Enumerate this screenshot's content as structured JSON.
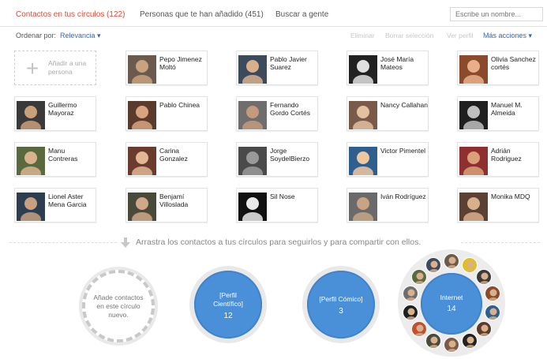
{
  "tabs": [
    {
      "label": "Contactos en tus círculos (122)",
      "active": true
    },
    {
      "label": "Personas que te han añadido (451)",
      "active": false
    },
    {
      "label": "Buscar a gente",
      "active": false
    }
  ],
  "search": {
    "placeholder": "Escribe un nombre..."
  },
  "toolbar": {
    "sort_label": "Ordenar por:",
    "sort_value": "Relevancia ▾",
    "actions": [
      "Eliminar",
      "Borrar selección",
      "Ver perfil"
    ],
    "more_actions": "Más acciones ▾"
  },
  "add_person": {
    "label": "Añadir a una persona"
  },
  "contacts": [
    {
      "name": "Pepo Jimenez Moltó"
    },
    {
      "name": "Pablo Javier Suarez"
    },
    {
      "name": "José María Mateos"
    },
    {
      "name": "Olivia Sanchez cortés"
    },
    {
      "name": "Guillermo Mayoraz"
    },
    {
      "name": "Pablo Chinea"
    },
    {
      "name": "Fernando Gordo Cortés"
    },
    {
      "name": "Nancy Callahan"
    },
    {
      "name": "Manuel M. Almeida"
    },
    {
      "name": "Manu Contreras"
    },
    {
      "name": "Carina Gonzalez"
    },
    {
      "name": "Jorge SoydelBierzo"
    },
    {
      "name": "Victor Pimentel"
    },
    {
      "name": "Adrián Rodriguez"
    },
    {
      "name": "Lionel Aster Mena Garcia"
    },
    {
      "name": "Benjamí Villoslada"
    },
    {
      "name": "Sil Nose"
    },
    {
      "name": "Iván Rodríguez"
    },
    {
      "name": "Monika MDQ"
    }
  ],
  "drag_hint": "Arrastra los contactos a tus círculos para seguirlos y para compartir con ellos.",
  "circles": {
    "new": "Añade contactos en este círculo nuevo.",
    "items": [
      {
        "name": "[Perfil Científico]",
        "count": "12"
      },
      {
        "name": "[Perfil Cómico]",
        "count": "3"
      },
      {
        "name": "Internet",
        "count": "14"
      }
    ]
  },
  "colors": {
    "accent_red": "#dd4b39",
    "link_blue": "#3366cc",
    "circle_blue": "#4a90d9"
  }
}
